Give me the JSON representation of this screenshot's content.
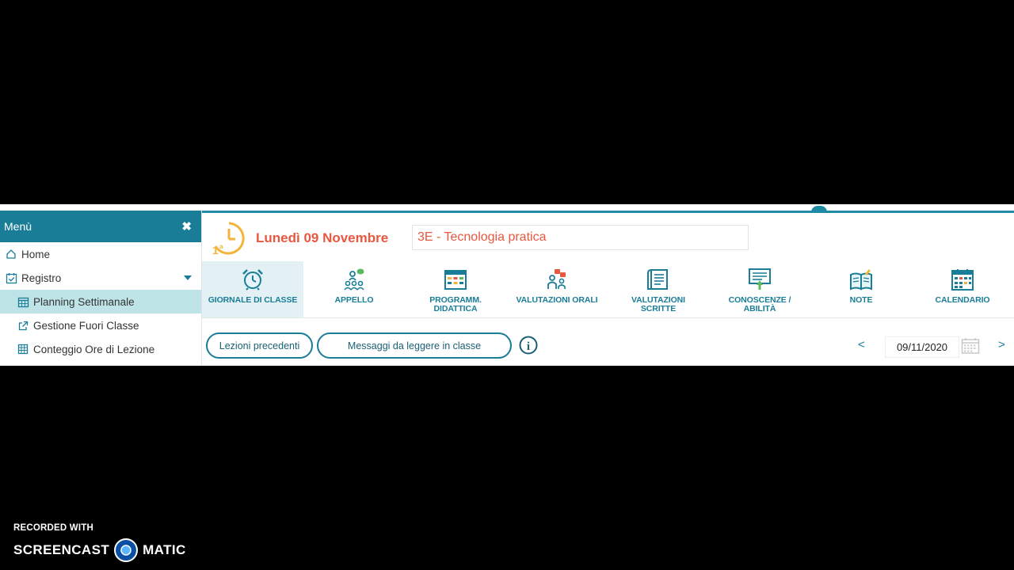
{
  "sidebar": {
    "title": "Menù",
    "close_glyph": "✖",
    "items": [
      {
        "label": "Home",
        "icon": "home-icon"
      },
      {
        "label": "Registro",
        "icon": "register-icon"
      },
      {
        "label": "Planning Settimanale",
        "icon": "calendar-icon",
        "active": true
      },
      {
        "label": "Gestione Fuori Classe",
        "icon": "external-link-icon"
      },
      {
        "label": "Conteggio Ore di Lezione",
        "icon": "grid-icon"
      }
    ]
  },
  "header": {
    "date_title": "Lunedì 09 Novembre",
    "class_name": "3E - Tecnologia pratica"
  },
  "toolbar": {
    "items": [
      {
        "label_lines": [
          "GIORNALE DI CLASSE"
        ],
        "icon": "alarm-clock-icon",
        "active": true
      },
      {
        "label_lines": [
          "APPELLO"
        ],
        "icon": "attendance-icon"
      },
      {
        "label_lines": [
          "PROGRAMM.",
          "DIDATTICA"
        ],
        "icon": "planner-icon"
      },
      {
        "label_lines": [
          "VALUTAZIONI ORALI"
        ],
        "icon": "oral-grades-icon"
      },
      {
        "label_lines": [
          "VALUTAZIONI",
          "SCRITTE"
        ],
        "icon": "written-grades-icon"
      },
      {
        "label_lines": [
          "CONOSCENZE /",
          "ABILITÀ"
        ],
        "icon": "skills-icon"
      },
      {
        "label_lines": [
          "NOTE"
        ],
        "icon": "notes-icon"
      },
      {
        "label_lines": [
          "CALENDARIO"
        ],
        "icon": "calendar-icon"
      }
    ]
  },
  "actions": {
    "prev_lessons": "Lezioni precedenti",
    "messages": "Messaggi da leggere in classe",
    "info_glyph": "i"
  },
  "date_nav": {
    "prev": "<",
    "next": ">",
    "date": "09/11/2020"
  },
  "watermark": {
    "line1": "RECORDED WITH",
    "left": "SCREENCAST",
    "right": "MATIC"
  },
  "colors": {
    "accent": "#1a7d97",
    "date_red": "#e8573f",
    "active_bg": "#bfe4e8",
    "clock_orange": "#f2b43a"
  }
}
